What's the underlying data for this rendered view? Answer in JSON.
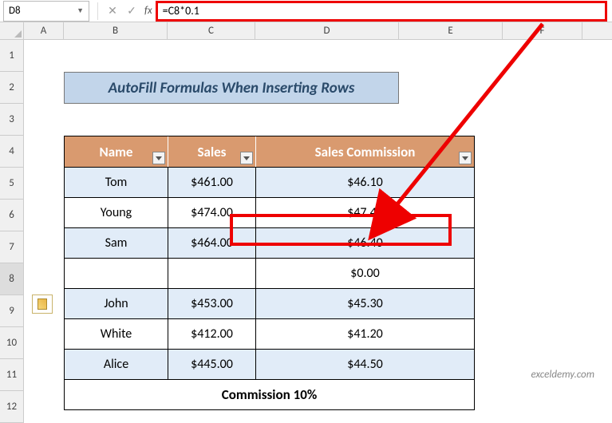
{
  "formula_bar": {
    "name_box": "D8",
    "formula": "=C8*0.1"
  },
  "columns": [
    "A",
    "B",
    "C",
    "D",
    "E",
    "F"
  ],
  "rows": [
    "1",
    "2",
    "3",
    "4",
    "5",
    "6",
    "7",
    "8",
    "9",
    "10",
    "11",
    "12"
  ],
  "title": "AutoFill Formulas When Inserting Rows",
  "headers": {
    "name": "Name",
    "sales": "Sales",
    "commission": "Sales Commission"
  },
  "data_rows": [
    {
      "name": "Tom",
      "sales": "$461.00",
      "commission": "$46.10",
      "band": "odd"
    },
    {
      "name": "Young",
      "sales": "$474.00",
      "commission": "$47.40",
      "band": "even"
    },
    {
      "name": "Sam",
      "sales": "$464.00",
      "commission": "$46.40",
      "band": "odd"
    },
    {
      "name": "",
      "sales": "",
      "commission": "$0.00",
      "band": "even"
    },
    {
      "name": "John",
      "sales": "$453.00",
      "commission": "$45.30",
      "band": "odd"
    },
    {
      "name": "White",
      "sales": "$412.00",
      "commission": "$41.20",
      "band": "even"
    },
    {
      "name": "Alice",
      "sales": "$445.00",
      "commission": "$44.50",
      "band": "odd"
    }
  ],
  "footer": "Commission 10%",
  "watermark": "exceldemy.com",
  "selected_row": "8"
}
